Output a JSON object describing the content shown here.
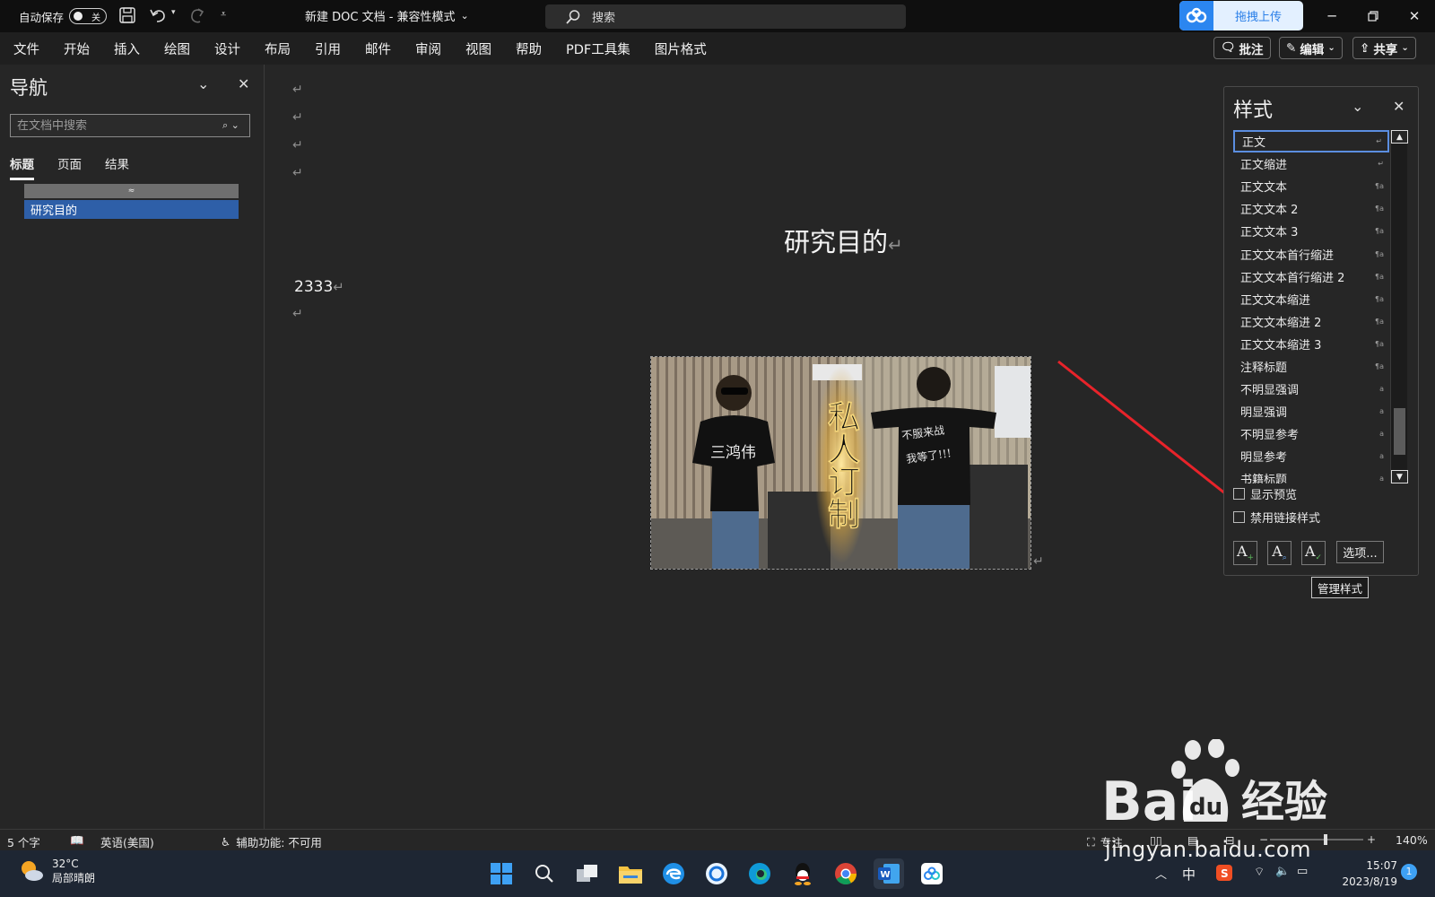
{
  "titlebar": {
    "autosave_label": "自动保存",
    "autosave_state": "关",
    "doc_title": "新建 DOC 文档  -  兼容性模式",
    "search_text": "搜索",
    "upload_label": "拖拽上传"
  },
  "menu": [
    "文件",
    "开始",
    "插入",
    "绘图",
    "设计",
    "布局",
    "引用",
    "邮件",
    "审阅",
    "视图",
    "帮助",
    "PDF工具集",
    "图片格式"
  ],
  "ribbon_right": {
    "comments": "批注",
    "editing": "编辑",
    "share": "共享"
  },
  "nav": {
    "title": "导航",
    "search_placeholder": "在文档中搜索",
    "tabs": [
      "标题",
      "页面",
      "结果"
    ],
    "heading_item": "研究目的"
  },
  "document": {
    "heading": "研究目的",
    "body_text": "2333",
    "photo_texts": {
      "left_shirt": "三鸿伟",
      "center": "私人订制",
      "right_shirt_1": "不服来战",
      "right_shirt_2": "我等了!!!"
    }
  },
  "styles_pane": {
    "title": "样式",
    "items": [
      {
        "name": "正文",
        "mark": "↵",
        "selected": true
      },
      {
        "name": "正文缩进",
        "mark": "↵"
      },
      {
        "name": "正文文本",
        "mark": "¶a"
      },
      {
        "name": "正文文本 2",
        "mark": "¶a"
      },
      {
        "name": "正文文本 3",
        "mark": "¶a"
      },
      {
        "name": "正文文本首行缩进",
        "mark": "¶a"
      },
      {
        "name": "正文文本首行缩进 2",
        "mark": "¶a"
      },
      {
        "name": "正文文本缩进",
        "mark": "¶a"
      },
      {
        "name": "正文文本缩进 2",
        "mark": "¶a"
      },
      {
        "name": "正文文本缩进 3",
        "mark": "¶a"
      },
      {
        "name": "注释标题",
        "mark": "¶a"
      },
      {
        "name": "不明显强调",
        "mark": "a"
      },
      {
        "name": "明显强调",
        "mark": "a"
      },
      {
        "name": "不明显参考",
        "mark": "a"
      },
      {
        "name": "明显参考",
        "mark": "a"
      },
      {
        "name": "书籍标题",
        "mark": "a"
      }
    ],
    "show_preview": "显示预览",
    "disable_linked": "禁用链接样式",
    "options_button": "选项...",
    "tooltip": "管理样式"
  },
  "statusbar": {
    "word_count": "5 个字",
    "language": "英语(美国)",
    "accessibility": "辅助功能: 不可用",
    "focus": "专注",
    "zoom": "140%"
  },
  "taskbar": {
    "temperature": "32°C",
    "weather": "局部晴朗",
    "ime": "中",
    "time": "15:07",
    "date": "2023/8/19",
    "notifications": "1"
  },
  "watermark": {
    "brand_latin": "Bai",
    "brand_cn": "经验",
    "url": "jingyan.baidu.com"
  },
  "colors": {
    "accent": "#2e5fa8",
    "arrow": "#e8232a",
    "upload": "#2b86f0"
  }
}
